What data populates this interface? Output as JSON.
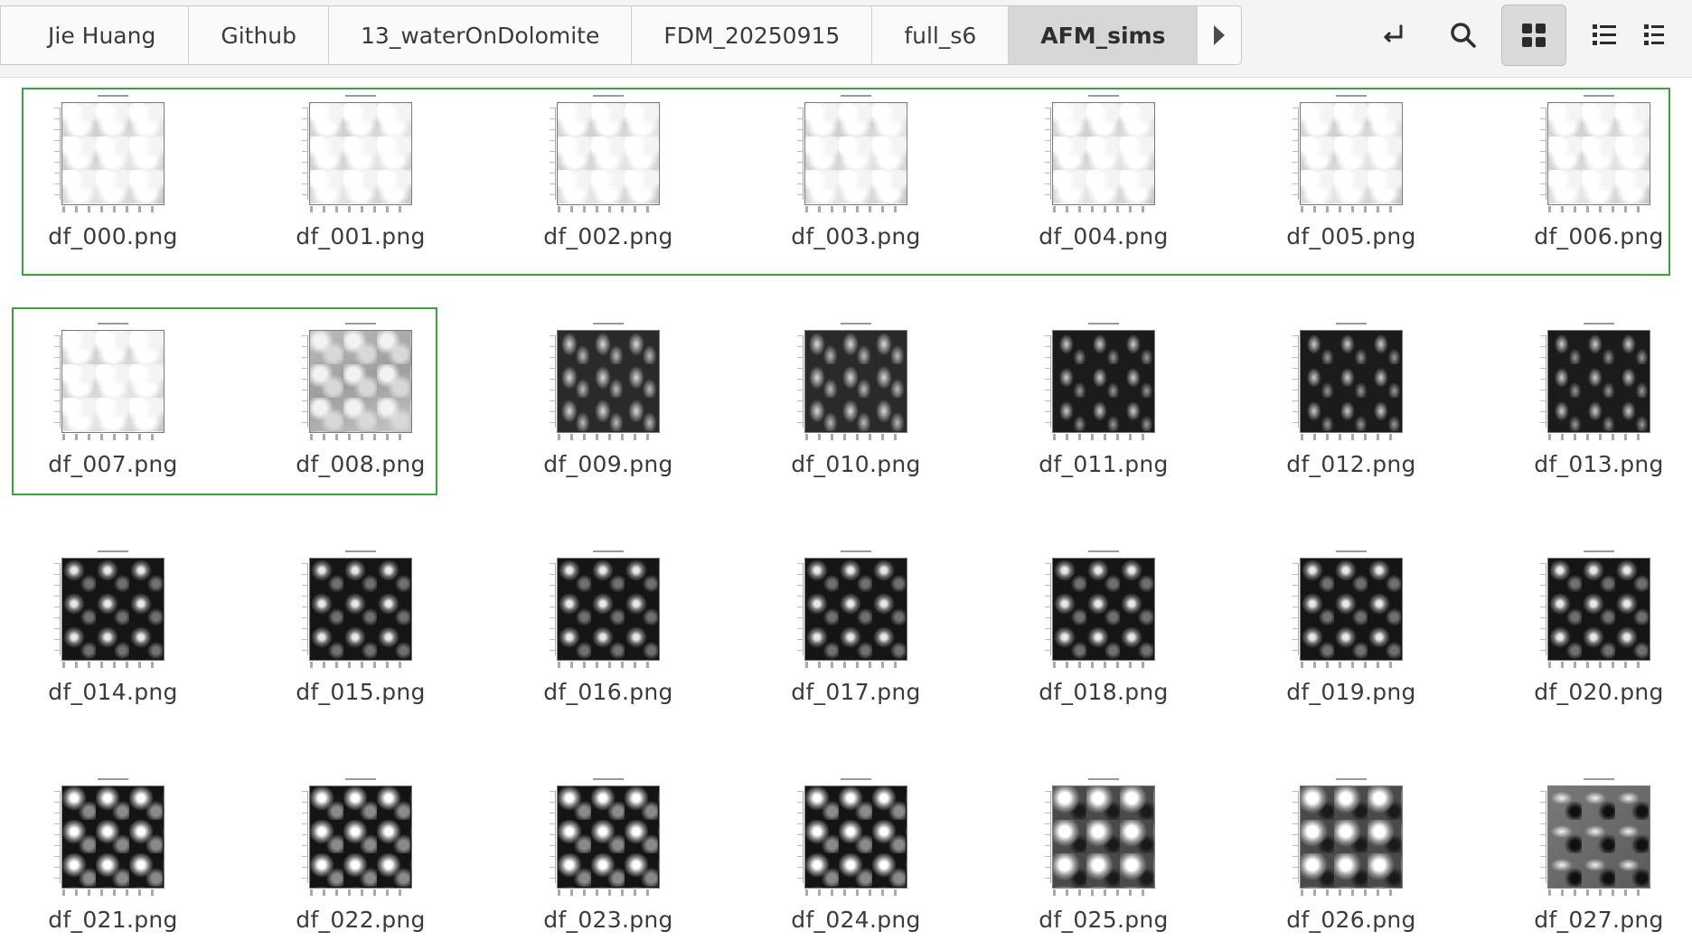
{
  "breadcrumbs": [
    "Jie Huang",
    "Github",
    "13_waterOnDolomite",
    "FDM_20250915",
    "full_s6",
    "AFM_sims"
  ],
  "toolbar": {
    "icons": [
      "enter-arrow-icon",
      "search-icon",
      "grid-view-icon",
      "list-view-icon",
      "compact-view-icon"
    ],
    "active_view": "grid-view-icon"
  },
  "files": [
    {
      "name": "df_000.png",
      "shade": "light"
    },
    {
      "name": "df_001.png",
      "shade": "light"
    },
    {
      "name": "df_002.png",
      "shade": "light"
    },
    {
      "name": "df_003.png",
      "shade": "light"
    },
    {
      "name": "df_004.png",
      "shade": "light"
    },
    {
      "name": "df_005.png",
      "shade": "light"
    },
    {
      "name": "df_006.png",
      "shade": "light"
    },
    {
      "name": "df_007.png",
      "shade": "light"
    },
    {
      "name": "df_008.png",
      "shade": "mid"
    },
    {
      "name": "df_009.png",
      "shade": "dark1"
    },
    {
      "name": "df_010.png",
      "shade": "dark1"
    },
    {
      "name": "df_011.png",
      "shade": "dark2"
    },
    {
      "name": "df_012.png",
      "shade": "dark2"
    },
    {
      "name": "df_013.png",
      "shade": "dark2"
    },
    {
      "name": "df_014.png",
      "shade": "dark3"
    },
    {
      "name": "df_015.png",
      "shade": "dark3"
    },
    {
      "name": "df_016.png",
      "shade": "dark3"
    },
    {
      "name": "df_017.png",
      "shade": "dark3"
    },
    {
      "name": "df_018.png",
      "shade": "dark3"
    },
    {
      "name": "df_019.png",
      "shade": "dark3"
    },
    {
      "name": "df_020.png",
      "shade": "dark3"
    },
    {
      "name": "df_021.png",
      "shade": "dark4"
    },
    {
      "name": "df_022.png",
      "shade": "dark4"
    },
    {
      "name": "df_023.png",
      "shade": "dark4"
    },
    {
      "name": "df_024.png",
      "shade": "dark4"
    },
    {
      "name": "df_025.png",
      "shade": "grey1"
    },
    {
      "name": "df_026.png",
      "shade": "grey1"
    },
    {
      "name": "df_027.png",
      "shade": "grey2"
    }
  ],
  "selection_color": "#3aa53a"
}
